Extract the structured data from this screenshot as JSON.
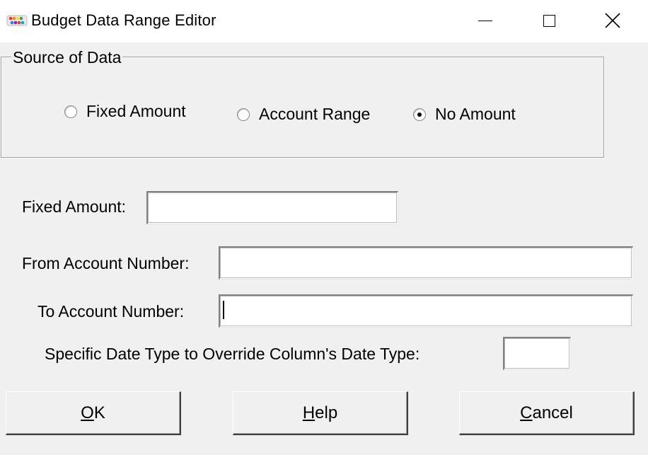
{
  "window": {
    "title": "Budget Data Range Editor",
    "app_icon": "abacus-icon",
    "controls": [
      "minimize-icon",
      "maximize-icon",
      "close-icon"
    ]
  },
  "source_group": {
    "legend": "Source of Data",
    "options": [
      {
        "label": "Fixed Amount",
        "checked": false
      },
      {
        "label": "Account Range",
        "checked": false
      },
      {
        "label": "No Amount",
        "checked": true
      }
    ]
  },
  "fields": {
    "fixed_amount": {
      "label": "Fixed Amount:",
      "value": ""
    },
    "from_account": {
      "label": "From Account Number:",
      "value": ""
    },
    "to_account": {
      "label": "To Account Number:",
      "value": ""
    },
    "date_type": {
      "label": "Specific Date Type to Override Column's Date Type:",
      "value": ""
    }
  },
  "buttons": {
    "ok": {
      "accel": "O",
      "rest": "K"
    },
    "help": {
      "accel": "H",
      "rest": "elp"
    },
    "cancel": {
      "accel": "C",
      "rest": "ancel"
    }
  }
}
